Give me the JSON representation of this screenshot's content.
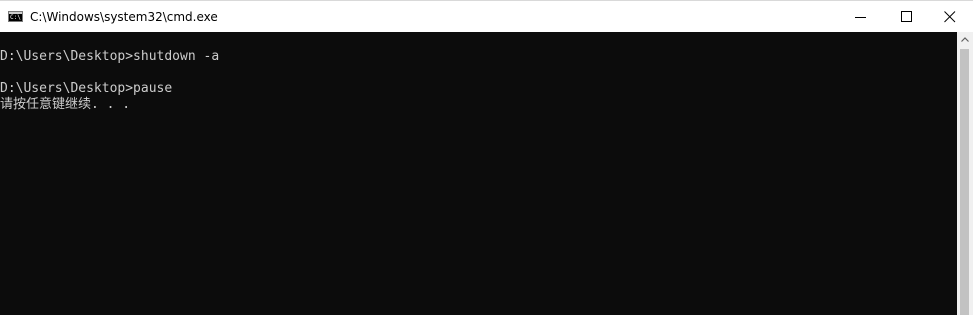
{
  "window": {
    "title": "C:\\Windows\\system32\\cmd.exe",
    "icon": "cmd-icon",
    "icon_glyph": "C:\\",
    "controls": {
      "minimize": "minimize-icon",
      "maximize": "maximize-icon",
      "close": "close-icon"
    }
  },
  "console": {
    "lines": [
      "D:\\Users\\Desktop>shutdown -a",
      "D:\\Users\\Desktop>pause",
      "请按任意键继续. . ."
    ],
    "background_color": "#0c0c0c",
    "text_color": "#cccccc"
  },
  "scrollbar": {
    "up_arrow": "chevron-up-icon"
  }
}
